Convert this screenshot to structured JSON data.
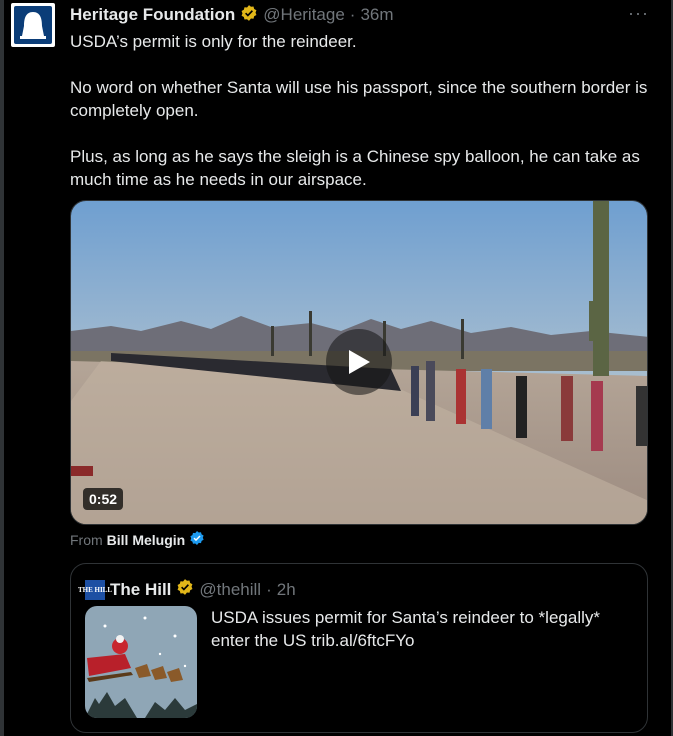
{
  "tweet": {
    "author_name": "Heritage Foundation",
    "handle": "@Heritage",
    "separator": "·",
    "time": "36m",
    "more_label": "···",
    "text_paragraphs": [
      "USDA’s permit is only for the reindeer.",
      "No word on whether Santa will use his passport, since the southern border is completely open.",
      "Plus, as long as he says the sleigh is a Chinese spy balloon, he can take as much time as he needs in our airspace."
    ]
  },
  "media": {
    "duration": "0:52",
    "from_label": "From",
    "from_name": "Bill Melugin"
  },
  "quote": {
    "logo_text": "THE HILL",
    "author_name": "The Hill",
    "handle": "@thehill",
    "separator": "·",
    "time": "2h",
    "text": "USDA issues permit for Santa’s reindeer to *legally* enter the US trib.al/6ftcFYo"
  },
  "colors": {
    "background": "#000000",
    "text": "#e7e9ea",
    "muted": "#71767b",
    "verified_gold": "#e2b719",
    "verified_blue": "#1d9bf0",
    "border": "#2f3336"
  },
  "icons": {
    "verified_org": "verified-gold-icon",
    "verified_user": "verified-blue-icon",
    "play": "play-icon",
    "more": "more-icon"
  }
}
